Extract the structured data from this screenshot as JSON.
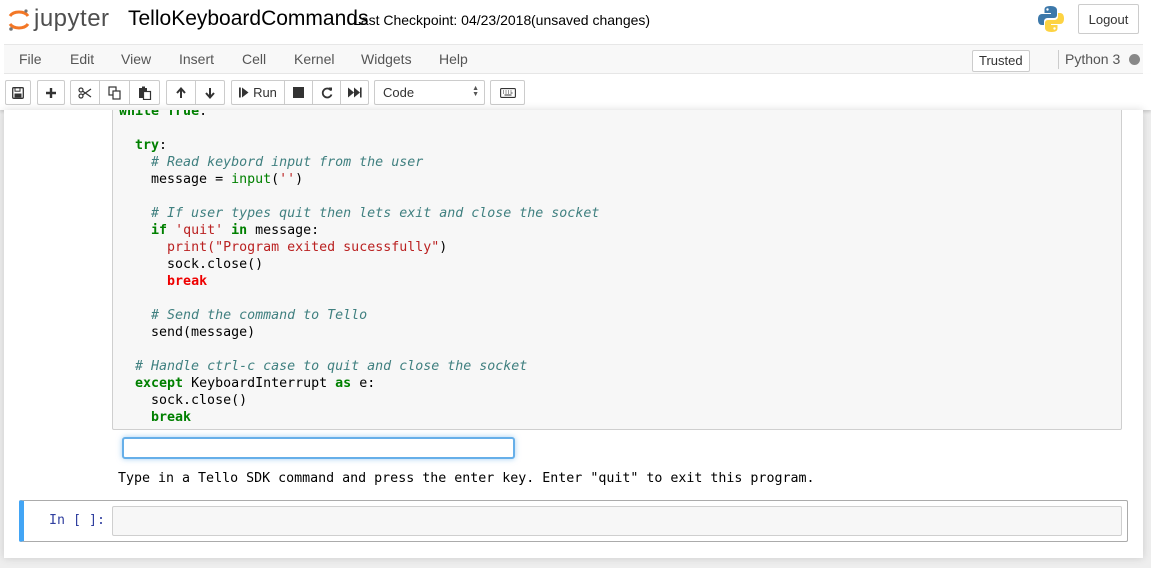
{
  "header": {
    "logo_text": "jupyter",
    "notebook_name": "TelloKeyboardCommands",
    "checkpoint": "Last Checkpoint: 04/23/2018",
    "autosave_status": "(unsaved changes)",
    "logout_label": "Logout",
    "kernel_logo_icon": "python-logo-icon"
  },
  "menubar": {
    "items": [
      "File",
      "Edit",
      "View",
      "Insert",
      "Cell",
      "Kernel",
      "Widgets",
      "Help"
    ],
    "trusted_label": "Trusted",
    "kernel_name": "Python 3"
  },
  "toolbar": {
    "buttons": [
      {
        "name": "save-icon"
      },
      {
        "name": "plus-icon"
      },
      {
        "name": "scissors-icon"
      },
      {
        "name": "copy-icon"
      },
      {
        "name": "paste-icon"
      },
      {
        "name": "arrow-up-icon"
      },
      {
        "name": "arrow-down-icon"
      },
      {
        "name": "run-icon",
        "label": "Run"
      },
      {
        "name": "stop-icon"
      },
      {
        "name": "restart-icon"
      },
      {
        "name": "fast-forward-icon"
      }
    ],
    "cell_type": "Code",
    "keyboard_icon": "keyboard-icon"
  },
  "cell": {
    "code_lines": [
      "while True:",
      "",
      "  try:",
      "    # Read keybord input from the user",
      "    message = input('')",
      "",
      "    # If user types quit then lets exit and close the socket",
      "    if 'quit' in message:",
      "      print(\"Program exited sucessfully\")",
      "      sock.close()",
      "      break",
      "",
      "    # Send the command to Tello",
      "    send(message)",
      "",
      "  # Handle ctrl-c case to quit and close the socket",
      "  except KeyboardInterrupt as e:",
      "    sock.close()",
      "    break"
    ],
    "stdin_value": "",
    "output": "Type in a Tello SDK command and press the enter key. Enter \"quit\" to exit this program."
  },
  "empty_cell": {
    "prompt": "In [ ]:"
  }
}
